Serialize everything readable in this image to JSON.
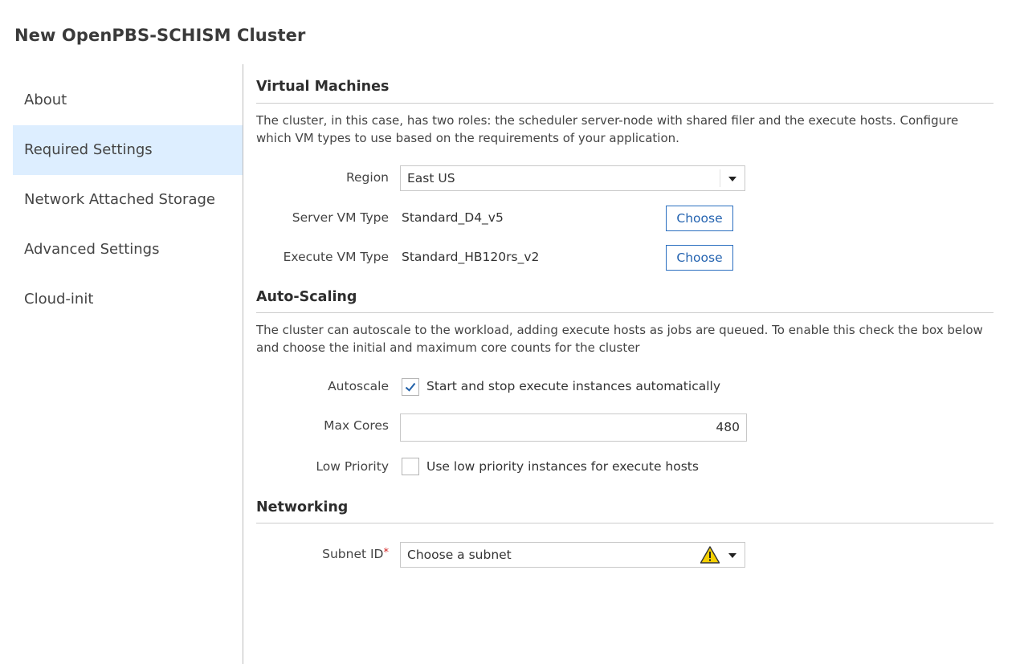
{
  "window": {
    "title": "New OpenPBS-SCHISM Cluster"
  },
  "sidebar": {
    "items": [
      {
        "label": "About",
        "active": false
      },
      {
        "label": "Required Settings",
        "active": true
      },
      {
        "label": "Network Attached Storage",
        "active": false
      },
      {
        "label": "Advanced Settings",
        "active": false
      },
      {
        "label": "Cloud-init",
        "active": false
      }
    ]
  },
  "virtual_machines": {
    "title": "Virtual Machines",
    "description": "The cluster, in this case, has two roles: the scheduler server-node with shared filer and the execute hosts. Configure which VM types to use based on the requirements of your application.",
    "region_label": "Region",
    "region_value": "East US",
    "server_vm_label": "Server VM Type",
    "server_vm_value": "Standard_D4_v5",
    "server_vm_button": "Choose",
    "execute_vm_label": "Execute VM Type",
    "execute_vm_value": "Standard_HB120rs_v2",
    "execute_vm_button": "Choose"
  },
  "auto_scaling": {
    "title": "Auto-Scaling",
    "description": "The cluster can autoscale to the workload, adding execute hosts as jobs are queued. To enable this check the box below and choose the initial and maximum core counts for the cluster",
    "autoscale_label": "Autoscale",
    "autoscale_checkbox_label": "Start and stop execute instances automatically",
    "autoscale_checked": true,
    "max_cores_label": "Max Cores",
    "max_cores_value": "480",
    "low_priority_label": "Low Priority",
    "low_priority_checkbox_label": "Use low priority instances for execute hosts",
    "low_priority_checked": false
  },
  "networking": {
    "title": "Networking",
    "subnet_label": "Subnet ID",
    "subnet_required_mark": "*",
    "subnet_placeholder": "Choose a subnet"
  },
  "colors": {
    "active_nav_bg": "#ddeeff",
    "button_border": "#2b6fc0",
    "required_mark": "#d02020",
    "warning_yellow": "#f5d000"
  },
  "icons": {
    "dropdown": "chevron-down-icon",
    "checkmark": "checkmark-icon",
    "warning": "warning-icon"
  }
}
